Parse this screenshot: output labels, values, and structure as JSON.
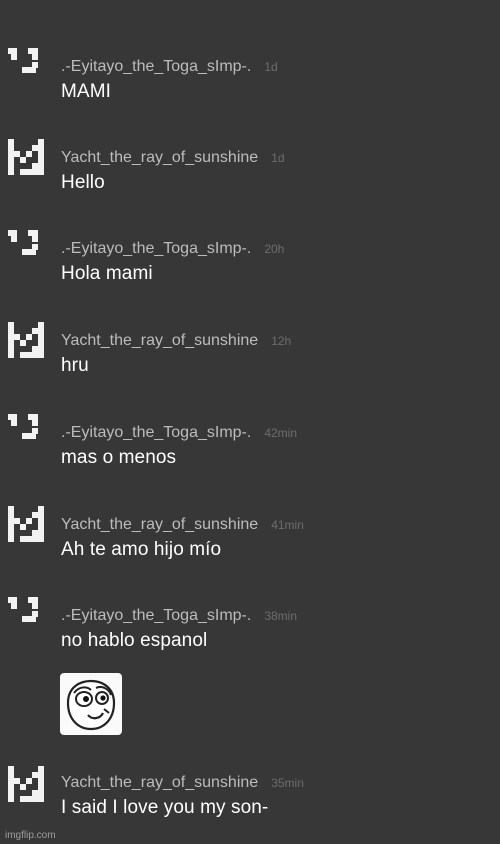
{
  "messages": [
    {
      "username": ".-Eyitayo_the_Toga_sImp-.",
      "time": "1d",
      "text": "MAMI",
      "avatar": "face-icon"
    },
    {
      "username": "Yacht_the_ray_of_sunshine",
      "time": "1d",
      "text": "Hello",
      "avatar": "pixel-robot-icon"
    },
    {
      "username": ".-Eyitayo_the_Toga_sImp-.",
      "time": "20h",
      "text": "Hola mami",
      "avatar": "face-icon"
    },
    {
      "username": "Yacht_the_ray_of_sunshine",
      "time": "12h",
      "text": "hru",
      "avatar": "pixel-robot-icon"
    },
    {
      "username": ".-Eyitayo_the_Toga_sImp-.",
      "time": "42min",
      "text": "mas o menos",
      "avatar": "face-icon"
    },
    {
      "username": "Yacht_the_ray_of_sunshine",
      "time": "41min",
      "text": "Ah te amo hijo mío",
      "avatar": "pixel-robot-icon"
    },
    {
      "username": ".-Eyitayo_the_Toga_sImp-.",
      "time": "38min",
      "text": "no hablo espanol",
      "avatar": "face-icon",
      "attachment": "meme-face-image"
    },
    {
      "username": "Yacht_the_ray_of_sunshine",
      "time": "35min",
      "text": "I said I love you my son-",
      "avatar": "pixel-robot-icon"
    }
  ],
  "watermark": "imgflip.com",
  "colors": {
    "background": "#373737",
    "username": "#bcbcbc",
    "timestamp": "#6d6d6d",
    "message": "#ffffff"
  }
}
